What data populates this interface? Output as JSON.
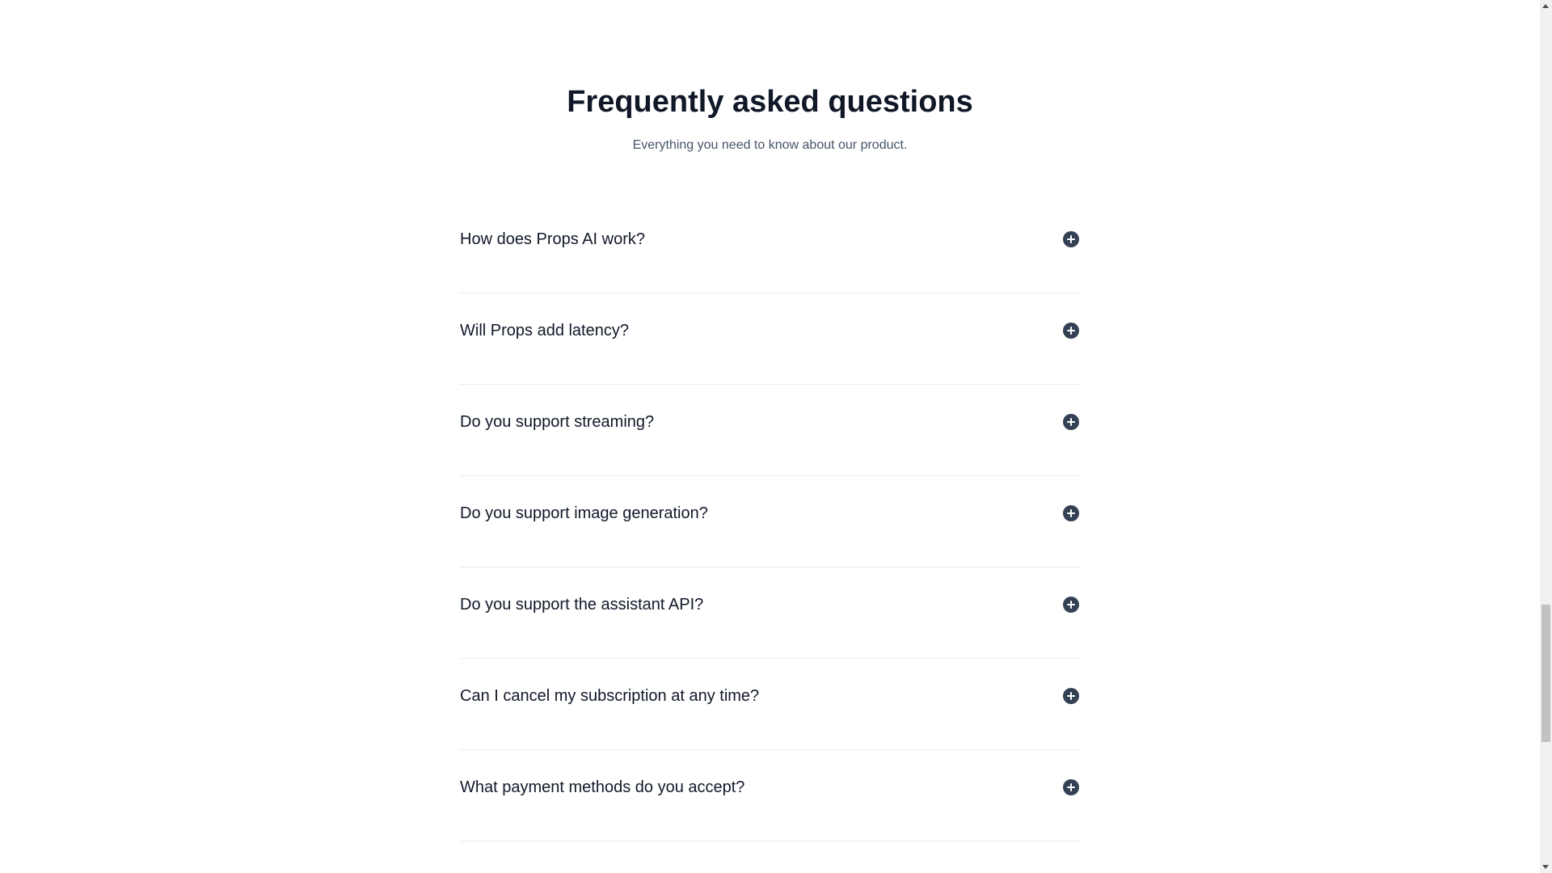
{
  "faq": {
    "title": "Frequently asked questions",
    "subtitle": "Everything you need to know about our product.",
    "toggle_icon": "plus-circle-icon",
    "items": [
      {
        "question": "How does Props AI work?"
      },
      {
        "question": "Will Props add latency?"
      },
      {
        "question": "Do you support streaming?"
      },
      {
        "question": "Do you support image generation?"
      },
      {
        "question": "Do you support the assistant API?"
      },
      {
        "question": "Can I cancel my subscription at any time?"
      },
      {
        "question": "What payment methods do you accept?"
      }
    ]
  },
  "colors": {
    "heading": "#101828",
    "subtext": "#475467",
    "icon": "#344054",
    "divider": "#eaecf0"
  }
}
